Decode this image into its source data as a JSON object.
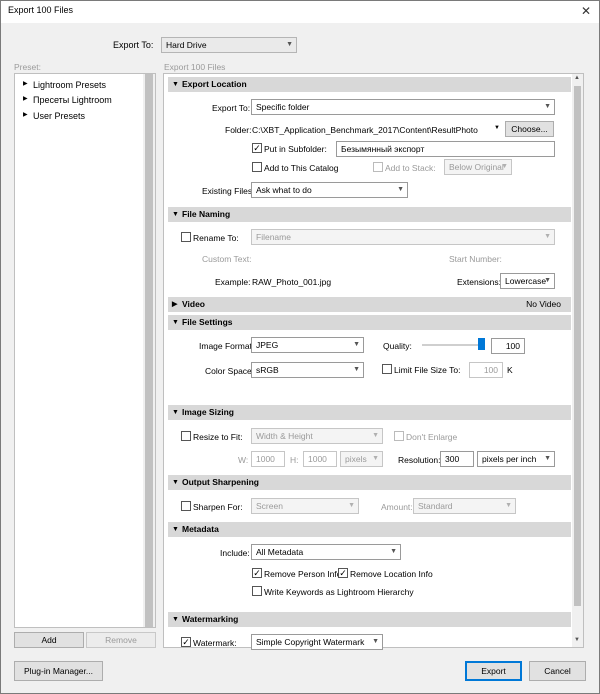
{
  "window": {
    "title": "Export 100 Files",
    "close_glyph": "✕"
  },
  "export_to": {
    "label": "Export To:",
    "value": "Hard Drive"
  },
  "preset": {
    "label": "Preset:",
    "items": [
      "Lightroom Presets",
      "Пресеты Lightroom",
      "User Presets"
    ],
    "add_label": "Add",
    "remove_label": "Remove"
  },
  "right_header": "Export 100 Files",
  "export_location": {
    "title": "Export Location",
    "export_to_label": "Export To:",
    "export_to_value": "Specific folder",
    "folder_label": "Folder:",
    "folder_value": "C:\\XBT_Application_Benchmark_2017\\Content\\ResultPhoto",
    "choose_label": "Choose...",
    "put_in_subfolder_label": "Put in Subfolder:",
    "put_in_subfolder_checked": true,
    "subfolder_value": "Безымянный экспорт",
    "add_to_catalog_label": "Add to This Catalog",
    "add_to_stack_label": "Add to Stack:",
    "stack_value": "Below Original",
    "existing_files_label": "Existing Files:",
    "existing_files_value": "Ask what to do"
  },
  "file_naming": {
    "title": "File Naming",
    "rename_label": "Rename To:",
    "rename_value": "Filename",
    "custom_text_label": "Custom Text:",
    "start_number_label": "Start Number:",
    "example_label": "Example:",
    "example_value": "RAW_Photo_001.jpg",
    "extensions_label": "Extensions:",
    "extensions_value": "Lowercase"
  },
  "video": {
    "title": "Video",
    "status": "No Video"
  },
  "file_settings": {
    "title": "File Settings",
    "image_format_label": "Image Format:",
    "image_format_value": "JPEG",
    "quality_label": "Quality:",
    "quality_value": "100",
    "quality_fraction": 1.0,
    "color_space_label": "Color Space:",
    "color_space_value": "sRGB",
    "limit_label": "Limit File Size To:",
    "limit_value": "100",
    "limit_unit": "K"
  },
  "image_sizing": {
    "title": "Image Sizing",
    "resize_label": "Resize to Fit:",
    "resize_value": "Width & Height",
    "dont_enlarge_label": "Don't Enlarge",
    "w_label": "W:",
    "w_value": "1000",
    "h_label": "H:",
    "h_value": "1000",
    "unit_value": "pixels",
    "resolution_label": "Resolution:",
    "resolution_value": "300",
    "resolution_unit": "pixels per inch"
  },
  "output_sharpening": {
    "title": "Output Sharpening",
    "sharpen_label": "Sharpen For:",
    "sharpen_value": "Screen",
    "amount_label": "Amount:",
    "amount_value": "Standard"
  },
  "metadata": {
    "title": "Metadata",
    "include_label": "Include:",
    "include_value": "All Metadata",
    "remove_person_label": "Remove Person Info",
    "remove_location_label": "Remove Location Info",
    "write_keywords_label": "Write Keywords as Lightroom Hierarchy"
  },
  "watermarking": {
    "title": "Watermarking",
    "watermark_label": "Watermark:",
    "watermark_value": "Simple Copyright Watermark"
  },
  "footer": {
    "plugin_manager_label": "Plug-in Manager...",
    "export_label": "Export",
    "cancel_label": "Cancel"
  },
  "glyphs": {
    "check": "✓",
    "down": "▼",
    "right": "▶",
    "up": "▲"
  },
  "colors": {
    "accent": "#0078d7",
    "section_header": "#d8d8d8",
    "disabled_text": "#9a9a9a"
  }
}
